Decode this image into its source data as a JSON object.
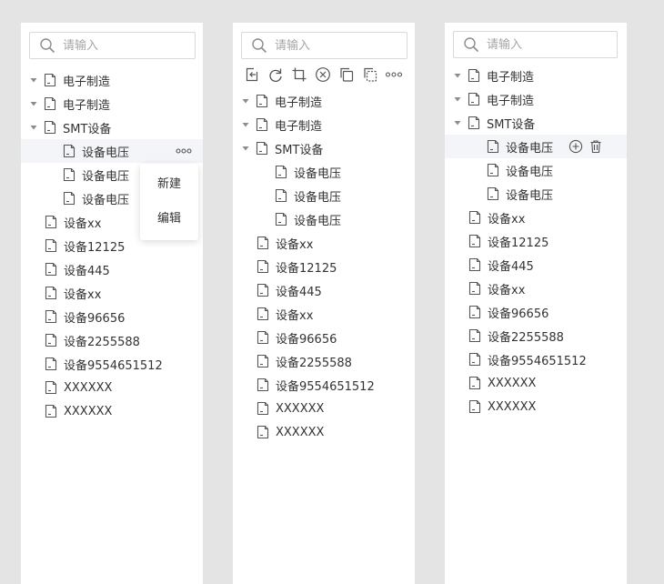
{
  "search": {
    "placeholder": "请输入"
  },
  "context_menu": {
    "items": [
      "新建",
      "编辑"
    ]
  },
  "toolbar": {
    "icons": [
      "import-icon",
      "redo-icon",
      "crop-icon",
      "cancel-icon",
      "copy-icon",
      "paste-icon",
      "more-icon"
    ]
  },
  "tree": {
    "root1": "电子制造",
    "root2": "电子制造",
    "root3": "SMT设备",
    "child1": "设备电压",
    "child2": "设备电压",
    "child3": "设备电压",
    "leaf1": "设备xx",
    "leaf2": "设备12125",
    "leaf3": "设备445",
    "leaf4": "设备xx",
    "leaf5": "设备96656",
    "leaf6": "设备2255588",
    "leaf7": "设备9554651512",
    "leaf8": "XXXXXX",
    "leaf9": "XXXXXX"
  },
  "colors": {
    "background": "#e4e4e4",
    "panel": "#ffffff",
    "selected_row": "#f3f5f8",
    "icon": "#555555"
  }
}
